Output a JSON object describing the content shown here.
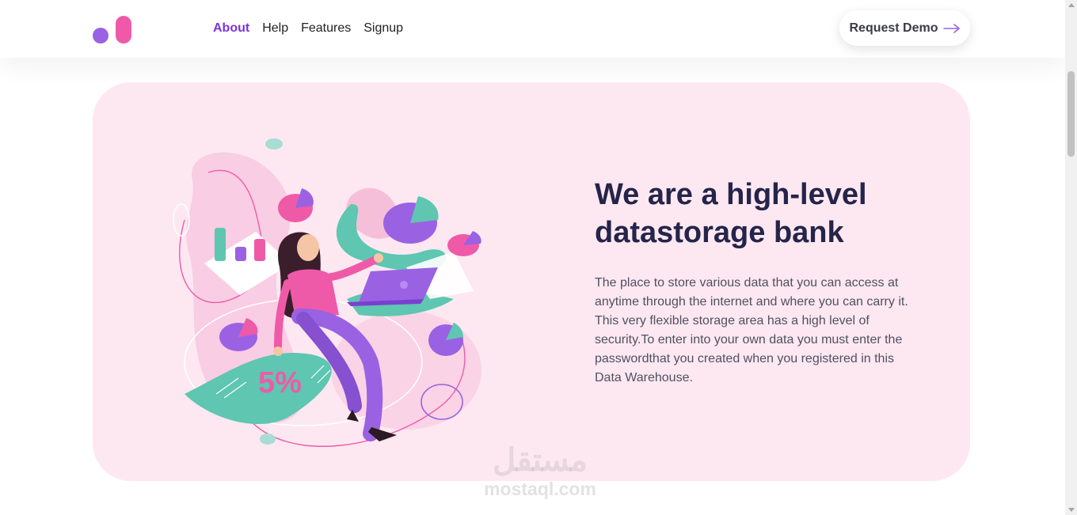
{
  "header": {
    "logo_colors": {
      "dot": "#9a62e3",
      "pill": "#ef5aa8"
    },
    "nav": [
      {
        "label": "About",
        "active": true
      },
      {
        "label": "Help",
        "active": false
      },
      {
        "label": "Features",
        "active": false
      },
      {
        "label": "Signup",
        "active": false
      }
    ],
    "cta": {
      "label": "Request Demo",
      "icon": "arrow-right-icon"
    }
  },
  "hero": {
    "title": "We are a high-level datastorage bank",
    "description": "The place to store various data that you can access at anytime through the internet and where you can carry it. This very flexible storage area has a high level of security.To enter into your own data you must enter the passwordthat you created when you registered in this Data Warehouse.",
    "illustration": {
      "badge_text": "5%",
      "colors": {
        "pink": "#ef5aa8",
        "purple": "#9a62e3",
        "teal": "#5ec6b1",
        "light_pink": "#f9cde3"
      }
    }
  },
  "watermark": {
    "arabic": "مستقل",
    "latin": "mostaql.com"
  },
  "colors": {
    "accent": "#7b34d6",
    "hero_bg": "#fde8f1",
    "heading": "#25244a",
    "body_text": "#505062"
  }
}
